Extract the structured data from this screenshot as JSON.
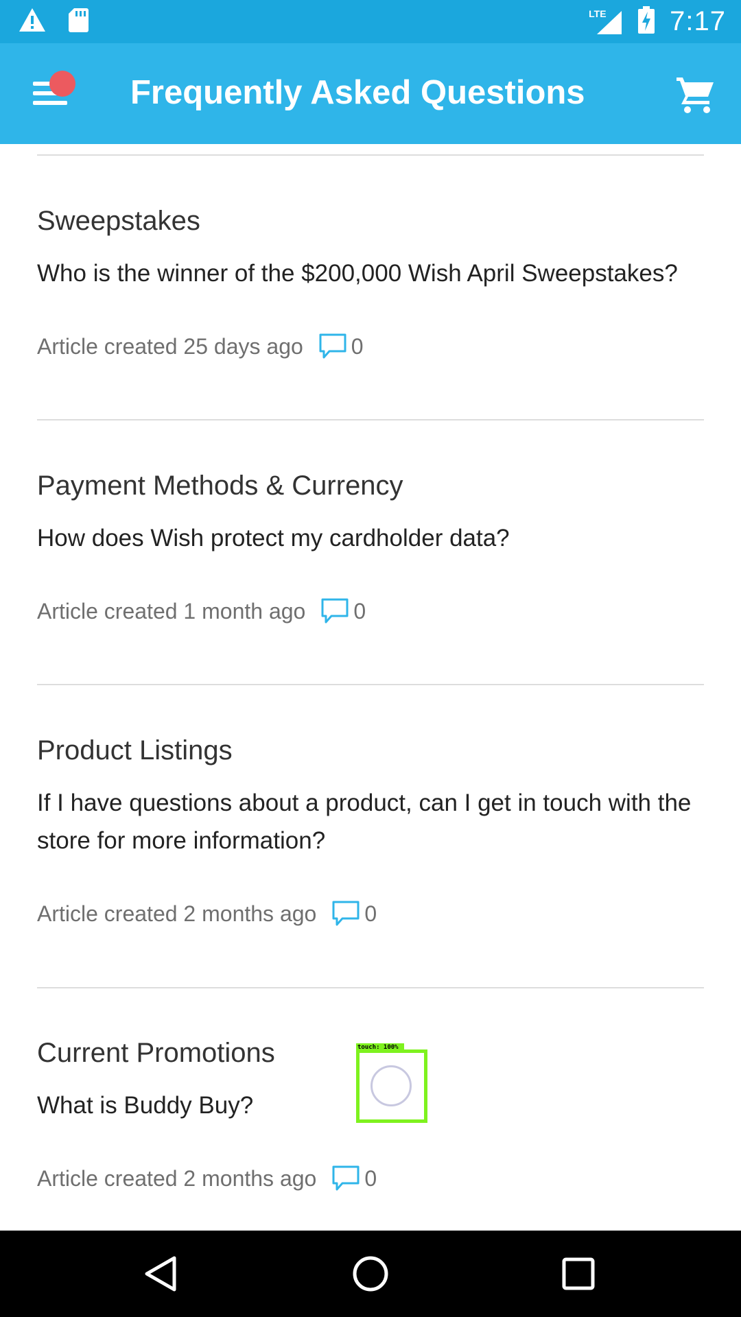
{
  "status_bar": {
    "time": "7:17",
    "network_label": "LTE",
    "icons": [
      "warning-icon",
      "sd-card-icon",
      "lte-signal-icon",
      "battery-charging-icon"
    ]
  },
  "toolbar": {
    "title": "Frequently Asked Questions",
    "menu_icon": "menu-icon",
    "cart_icon": "cart-icon",
    "notification_color": "#ec5a5f"
  },
  "articles": [
    {
      "category": "Sweepstakes",
      "question": "Who is the winner of the $200,000 Wish April Sweepstakes?",
      "meta": "Article created 25 days ago",
      "comments": "0"
    },
    {
      "category": "Payment Methods & Currency",
      "question": "How does Wish protect my cardholder data?",
      "meta": "Article created 1 month ago",
      "comments": "0"
    },
    {
      "category": "Product Listings",
      "question": "If I have questions about a product, can I get in touch with the store for more information?",
      "meta": "Article created 2 months ago",
      "comments": "0"
    },
    {
      "category": "Current Promotions",
      "question": "What is Buddy Buy?",
      "meta": "Article created 2 months ago",
      "comments": "0"
    }
  ],
  "touch_indicator": {
    "label": "touch: 100%"
  },
  "nav_bar": {
    "icons": [
      "back-icon",
      "home-icon",
      "recents-icon"
    ]
  },
  "colors": {
    "status_bar": "#1ba7dd",
    "toolbar": "#2fb5e9",
    "accent": "#2fb5e9",
    "touch_highlight": "#7ef21e"
  }
}
